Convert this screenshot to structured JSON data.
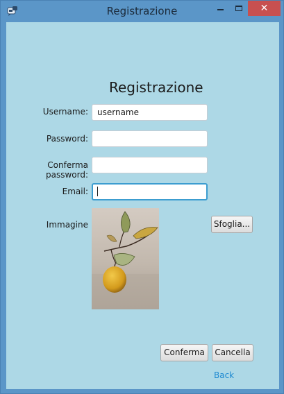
{
  "window": {
    "title": "Registrazione",
    "close_glyph": "✕"
  },
  "form": {
    "heading": "Registrazione",
    "username": {
      "label": "Username:",
      "value": "username"
    },
    "password": {
      "label": "Password:",
      "value": ""
    },
    "confirm_password": {
      "label": "Conferma password:",
      "value": ""
    },
    "email": {
      "label": "Email:",
      "value": ""
    },
    "image": {
      "label": "Immagine"
    },
    "browse_label": "Sfoglia...",
    "confirm_label": "Conferma",
    "cancel_label": "Cancella",
    "back_label": "Back"
  },
  "colors": {
    "titlebar": "#5b96c8",
    "background": "#add8e6",
    "close_button": "#c75050",
    "focus_border": "#3c9dd0",
    "link": "#1f8ad1"
  },
  "icons": {
    "app": "java-app-icon",
    "minimize": "minimize-icon",
    "maximize": "maximize-icon",
    "close": "close-icon"
  }
}
